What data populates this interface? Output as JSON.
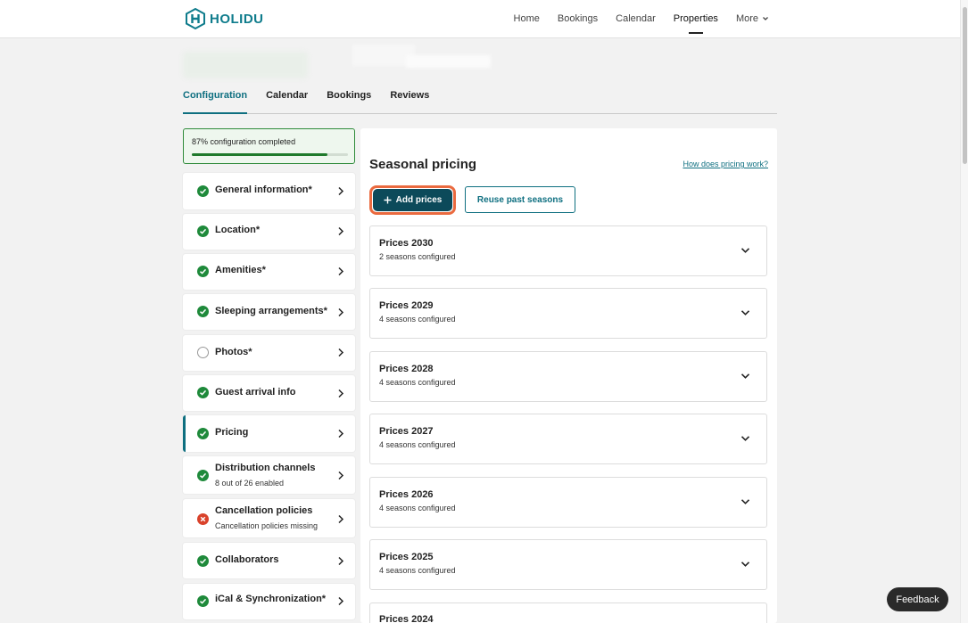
{
  "brand": {
    "name": "HOLIDU",
    "color": "#0f7c8c"
  },
  "nav": {
    "items": [
      "Home",
      "Bookings",
      "Calendar",
      "Properties"
    ],
    "active": "Properties",
    "more_label": "More"
  },
  "tabs": {
    "items": [
      "Configuration",
      "Calendar",
      "Bookings",
      "Reviews"
    ],
    "active": "Configuration"
  },
  "progress": {
    "label": "87% configuration completed",
    "percent": 87
  },
  "sidebar": {
    "items": [
      {
        "label": "General information*",
        "status": "complete",
        "icon": "check-circle-icon"
      },
      {
        "label": "Location*",
        "status": "complete",
        "icon": "check-circle-icon"
      },
      {
        "label": "Amenities*",
        "status": "complete",
        "icon": "check-circle-icon"
      },
      {
        "label": "Sleeping arrangements*",
        "status": "complete",
        "icon": "check-circle-icon"
      },
      {
        "label": "Photos*",
        "status": "incomplete",
        "icon": "empty-circle-icon"
      },
      {
        "label": "Guest arrival info",
        "status": "complete",
        "icon": "check-circle-icon"
      },
      {
        "label": "Pricing",
        "status": "complete",
        "icon": "check-circle-icon",
        "active": true
      },
      {
        "label": "Distribution channels",
        "sub": "8 out of 26 enabled",
        "status": "complete",
        "icon": "check-circle-icon"
      },
      {
        "label": "Cancellation policies",
        "sub": "Cancellation policies missing",
        "status": "error",
        "icon": "error-circle-icon"
      },
      {
        "label": "Collaborators",
        "status": "complete",
        "icon": "check-circle-icon"
      },
      {
        "label": "iCal & Synchronization*",
        "status": "complete",
        "icon": "check-circle-icon"
      }
    ]
  },
  "main": {
    "title": "Seasonal pricing",
    "help_link": "How does pricing work?",
    "add_button": "Add prices",
    "reuse_button": "Reuse past seasons",
    "years": [
      {
        "title": "Prices 2030",
        "sub": "2 seasons configured"
      },
      {
        "title": "Prices 2029",
        "sub": "4 seasons configured"
      },
      {
        "title": "Prices 2028",
        "sub": "4 seasons configured"
      },
      {
        "title": "Prices 2027",
        "sub": "4 seasons configured"
      },
      {
        "title": "Prices 2026",
        "sub": "4 seasons configured"
      },
      {
        "title": "Prices 2025",
        "sub": "4 seasons configured"
      },
      {
        "title": "Prices 2024",
        "sub": ""
      }
    ]
  },
  "feedback": "Feedback",
  "colors": {
    "accent": "#0e6f80",
    "primary_button": "#0c4a5a",
    "focus_ring": "#ea6a3f",
    "success": "#1f8a3b",
    "error": "#d9422b"
  }
}
